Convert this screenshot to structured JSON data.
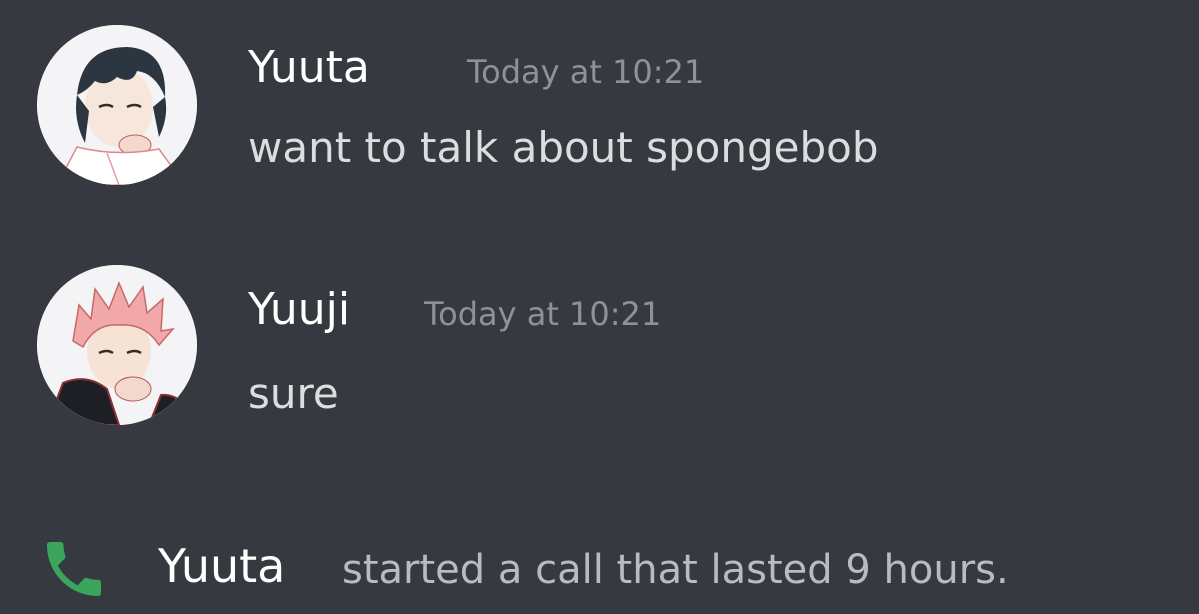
{
  "messages": [
    {
      "username": "Yuuta",
      "timestamp": "Today at 10:21",
      "content": "want to talk about spongebob",
      "avatar_icon": "anime-avatar-dark-hair"
    },
    {
      "username": "Yuuji",
      "timestamp": "Today at 10:21",
      "content": "sure",
      "avatar_icon": "anime-avatar-pink-hair"
    }
  ],
  "system_message": {
    "icon": "phone-icon",
    "username": "Yuuta",
    "text": "started a call that lasted 9 hours."
  },
  "colors": {
    "background": "#36393f",
    "username": "#ffffff",
    "timestamp": "#8e9297",
    "message_text": "#dcddde",
    "call_icon": "#3ba55d"
  }
}
